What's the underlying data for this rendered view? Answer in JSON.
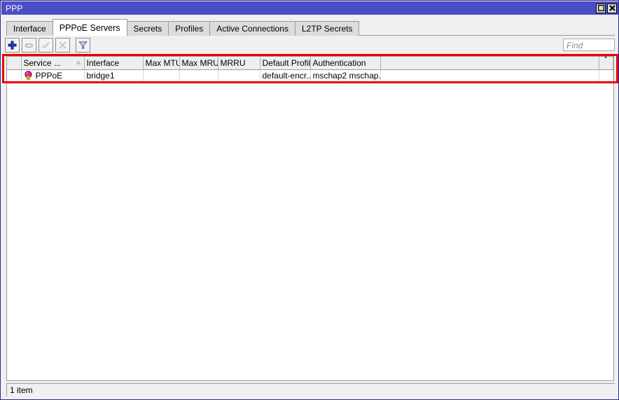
{
  "window": {
    "title": "PPP",
    "buttons": [
      {
        "name": "maximize-button",
        "icon": "square-icon",
        "label": ""
      },
      {
        "name": "close-button",
        "icon": "close-icon",
        "label": ""
      }
    ]
  },
  "tabs": [
    {
      "label": "Interface",
      "active": false
    },
    {
      "label": "PPPoE Servers",
      "active": true
    },
    {
      "label": "Secrets",
      "active": false
    },
    {
      "label": "Profiles",
      "active": false
    },
    {
      "label": "Active Connections",
      "active": false
    },
    {
      "label": "L2TP Secrets",
      "active": false
    }
  ],
  "toolbar": {
    "add_label": "+",
    "remove_label": "-",
    "enable_label": "",
    "disable_label": "",
    "filter_label": "",
    "icons": [
      "plus-icon",
      "minus-icon",
      "check-icon",
      "cross-icon",
      "filter-funnel-icon"
    ]
  },
  "search": {
    "value": "",
    "placeholder": "Find"
  },
  "table": {
    "columns": [
      {
        "label": "Service ...",
        "sorted": true,
        "sort_direction": "ascending"
      },
      {
        "label": "Interface",
        "sorted": false
      },
      {
        "label": "Max MTU",
        "sorted": false
      },
      {
        "label": "Max MRU",
        "sorted": false
      },
      {
        "label": "MRRU",
        "sorted": false
      },
      {
        "label": "Default Profile",
        "sorted": false
      },
      {
        "label": "Authentication",
        "sorted": false
      }
    ],
    "rows": [
      {
        "icon": "pppoe-server-icon",
        "service": "PPPoE",
        "interface": "bridge1",
        "max_mtu": "",
        "max_mru": "",
        "mrru": "",
        "default_profile": "default-encr...",
        "authentication": "mschap2 mschap..."
      }
    ]
  },
  "status": {
    "item_count_label": "1 item"
  },
  "colors": {
    "titlebar": "#4b4ec6",
    "annotation_highlight": "#ee0000",
    "window_chrome": "#f0f0f0",
    "grid_header": "#eeeeee",
    "row_icon_primary": "#e0169b",
    "row_icon_accent": "#f2d024",
    "add_icon": "#1f3fcf"
  }
}
